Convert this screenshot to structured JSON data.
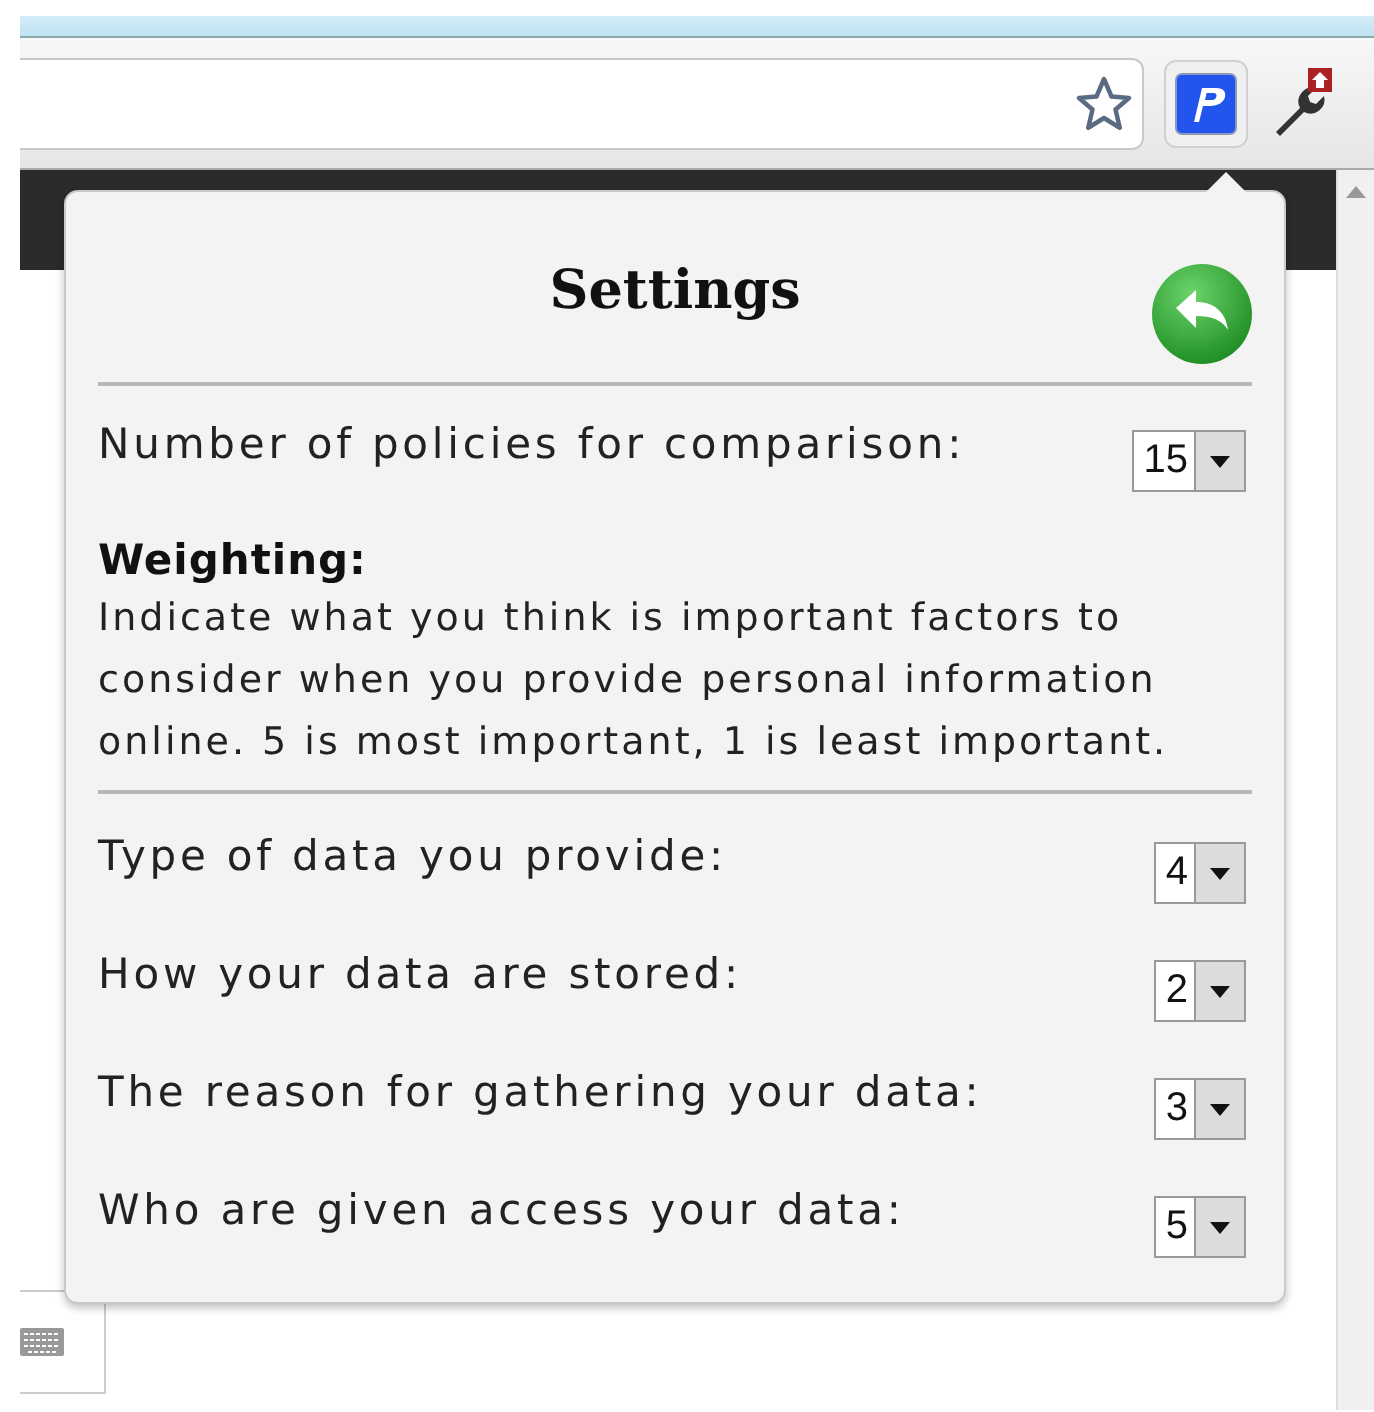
{
  "title": "Settings",
  "policies": {
    "label": "Number of policies for comparison:",
    "value": "15"
  },
  "weighting": {
    "heading": "Weighting:",
    "description": "Indicate what you think is important factors to consider when you provide personal information online. 5 is most important, 1 is least important."
  },
  "factors": [
    {
      "label": "Type of data you provide:",
      "value": "4"
    },
    {
      "label": "How your data are stored:",
      "value": "2"
    },
    {
      "label": "The reason for gathering your data:",
      "value": "3"
    },
    {
      "label": "Who are given access your data:",
      "value": "5"
    }
  ]
}
